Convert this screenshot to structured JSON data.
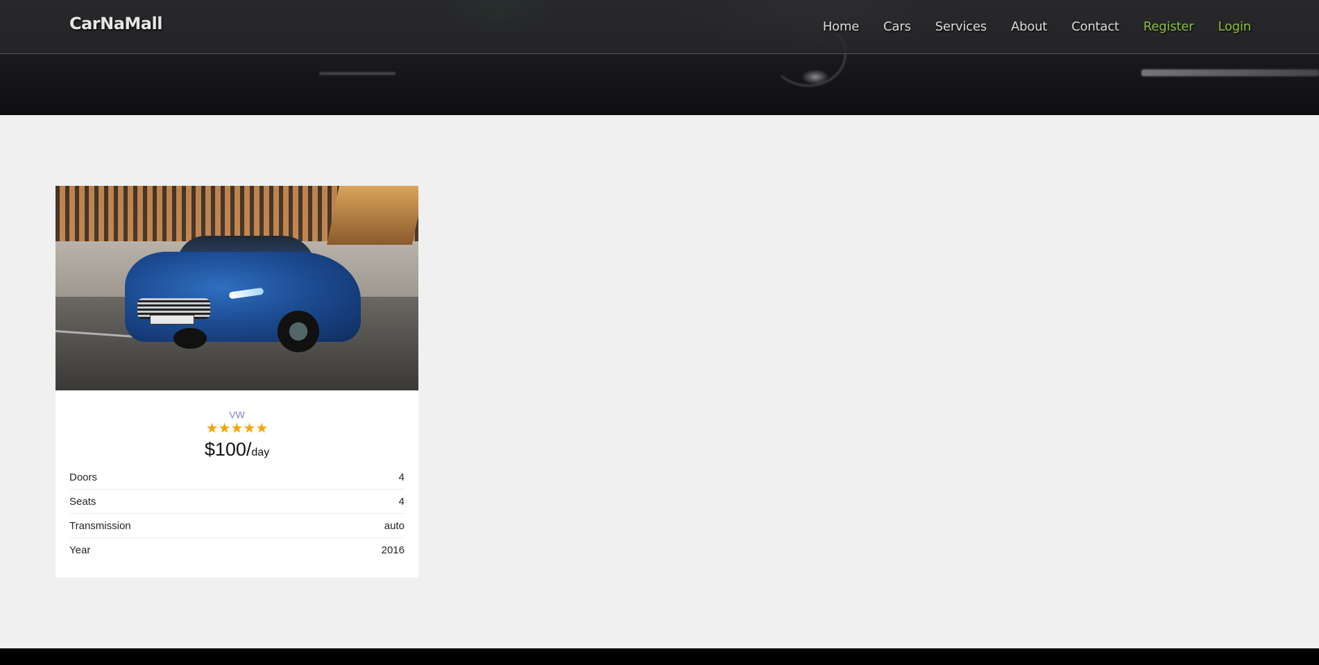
{
  "navbar": {
    "brand": "CarNaMall",
    "links": [
      {
        "label": "Home"
      },
      {
        "label": "Cars"
      },
      {
        "label": "Services"
      },
      {
        "label": "About"
      },
      {
        "label": "Contact"
      },
      {
        "label": "Register"
      },
      {
        "label": "Login"
      }
    ],
    "accent_color": "#8bbf3c"
  },
  "car_card": {
    "image_icon": "car-photo",
    "make": "VW",
    "rating_stars": "★★★★★",
    "rating": 5,
    "price": "$100/",
    "price_unit": "day",
    "specs": [
      {
        "label": "Doors",
        "value": "4"
      },
      {
        "label": "Seats",
        "value": "4"
      },
      {
        "label": "Transmission",
        "value": "auto"
      },
      {
        "label": "Year",
        "value": "2016"
      }
    ],
    "make_color": "#7c7ecc",
    "star_color": "#f5a300"
  }
}
